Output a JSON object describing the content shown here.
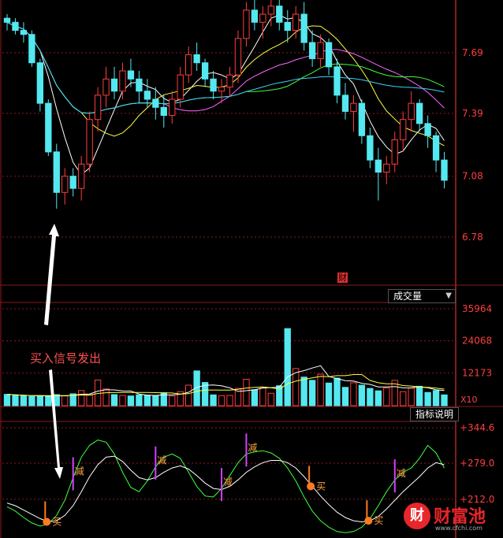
{
  "colors": {
    "up": "#ff3d3d",
    "down": "#54e8f0",
    "axis": "#ff3d3d",
    "grid": "#8b1a1a"
  },
  "price_panel": {
    "ticks": [
      "7.69",
      "7.39",
      "7.08",
      "6.78"
    ],
    "marker_label": "财"
  },
  "volume_panel": {
    "selector_label": "成交量",
    "ticks": [
      "35964",
      "24068",
      "12173"
    ],
    "unit_label": "X10"
  },
  "indicator_panel": {
    "button_label": "指标说明",
    "ticks": [
      "+344.6",
      "+279.0",
      "+212.0"
    ],
    "reduce_label": "减",
    "buy_label": "买"
  },
  "annotation": {
    "text": "买入信号发出"
  },
  "watermark": {
    "icon_text": "财",
    "name": "财富池",
    "url": "www.cfchi.com"
  },
  "chart_data": {
    "type": "candlestick",
    "price_range": [
      6.55,
      7.95
    ],
    "volume_range": [
      0,
      38000
    ],
    "indicator_range": [
      140,
      355
    ],
    "candles": [
      [
        7.86,
        7.88,
        7.8,
        7.84
      ],
      [
        7.84,
        7.86,
        7.78,
        7.8
      ],
      [
        7.8,
        7.84,
        7.74,
        7.78
      ],
      [
        7.78,
        7.8,
        7.62,
        7.64
      ],
      [
        7.64,
        7.66,
        7.4,
        7.44
      ],
      [
        7.44,
        7.46,
        7.18,
        7.2
      ],
      [
        7.2,
        7.24,
        6.92,
        7.0
      ],
      [
        7.0,
        7.12,
        6.94,
        7.08
      ],
      [
        7.08,
        7.12,
        6.98,
        7.02
      ],
      [
        7.02,
        7.18,
        6.96,
        7.14
      ],
      [
        7.14,
        7.4,
        7.1,
        7.36
      ],
      [
        7.36,
        7.52,
        7.3,
        7.48
      ],
      [
        7.48,
        7.62,
        7.42,
        7.56
      ],
      [
        7.56,
        7.62,
        7.46,
        7.5
      ],
      [
        7.5,
        7.64,
        7.46,
        7.6
      ],
      [
        7.6,
        7.66,
        7.52,
        7.56
      ],
      [
        7.56,
        7.6,
        7.44,
        7.5
      ],
      [
        7.5,
        7.56,
        7.42,
        7.46
      ],
      [
        7.46,
        7.52,
        7.36,
        7.42
      ],
      [
        7.42,
        7.48,
        7.32,
        7.38
      ],
      [
        7.38,
        7.5,
        7.34,
        7.46
      ],
      [
        7.46,
        7.62,
        7.42,
        7.58
      ],
      [
        7.58,
        7.72,
        7.54,
        7.68
      ],
      [
        7.68,
        7.74,
        7.6,
        7.64
      ],
      [
        7.64,
        7.66,
        7.52,
        7.56
      ],
      [
        7.56,
        7.6,
        7.46,
        7.5
      ],
      [
        7.5,
        7.56,
        7.44,
        7.52
      ],
      [
        7.52,
        7.62,
        7.48,
        7.58
      ],
      [
        7.58,
        7.8,
        7.54,
        7.76
      ],
      [
        7.76,
        7.94,
        7.72,
        7.9
      ],
      [
        7.9,
        7.95,
        7.8,
        7.84
      ],
      [
        7.84,
        7.92,
        7.76,
        7.88
      ],
      [
        7.88,
        7.95,
        7.82,
        7.92
      ],
      [
        7.92,
        7.95,
        7.8,
        7.84
      ],
      [
        7.84,
        7.9,
        7.74,
        7.8
      ],
      [
        7.8,
        7.92,
        7.76,
        7.88
      ],
      [
        7.88,
        7.94,
        7.7,
        7.74
      ],
      [
        7.74,
        7.8,
        7.62,
        7.66
      ],
      [
        7.66,
        7.78,
        7.62,
        7.74
      ],
      [
        7.74,
        7.76,
        7.58,
        7.62
      ],
      [
        7.62,
        7.66,
        7.44,
        7.48
      ],
      [
        7.48,
        7.54,
        7.36,
        7.4
      ],
      [
        7.4,
        7.48,
        7.3,
        7.44
      ],
      [
        7.44,
        7.46,
        7.24,
        7.28
      ],
      [
        7.28,
        7.32,
        7.12,
        7.16
      ],
      [
        7.16,
        7.22,
        6.96,
        7.1
      ],
      [
        7.1,
        7.18,
        7.04,
        7.14
      ],
      [
        7.14,
        7.3,
        7.1,
        7.26
      ],
      [
        7.26,
        7.4,
        7.2,
        7.36
      ],
      [
        7.36,
        7.5,
        7.3,
        7.44
      ],
      [
        7.44,
        7.46,
        7.3,
        7.34
      ],
      [
        7.34,
        7.38,
        7.22,
        7.28
      ],
      [
        7.28,
        7.3,
        7.1,
        7.16
      ],
      [
        7.16,
        7.2,
        7.02,
        7.06
      ]
    ],
    "volumes": [
      4200,
      3800,
      3600,
      3400,
      3700,
      3500,
      4100,
      3600,
      4400,
      5600,
      3900,
      9500,
      6200,
      4100,
      3800,
      3600,
      4000,
      3900,
      3700,
      4800,
      3600,
      5200,
      7600,
      12900,
      8600,
      4000,
      3700,
      3800,
      6400,
      9800,
      5900,
      6800,
      4600,
      7400,
      28600,
      13800,
      10600,
      9400,
      11700,
      8400,
      10200,
      6800,
      8500,
      7600,
      6400,
      5500,
      6600,
      9400,
      5200,
      6500,
      7200,
      4900,
      5600,
      4000
    ],
    "indicator": {
      "k": [
        198,
        190,
        178,
        168,
        162,
        166,
        182,
        210,
        252,
        290,
        312,
        322,
        318,
        296,
        262,
        234,
        226,
        246,
        272,
        290,
        296,
        288,
        262,
        236,
        218,
        216,
        232,
        256,
        280,
        296,
        300,
        302,
        298,
        288,
        270,
        246,
        216,
        190,
        172,
        160,
        152,
        150,
        152,
        160,
        176,
        200,
        226,
        248,
        262,
        270,
        288,
        312,
        298,
        270
      ],
      "d": [
        205,
        200,
        192,
        184,
        176,
        170,
        172,
        182,
        200,
        226,
        254,
        276,
        290,
        292,
        282,
        266,
        252,
        248,
        252,
        262,
        270,
        274,
        268,
        256,
        242,
        232,
        230,
        236,
        248,
        262,
        272,
        280,
        284,
        284,
        280,
        270,
        254,
        236,
        218,
        202,
        188,
        178,
        172,
        170,
        172,
        180,
        194,
        210,
        226,
        240,
        254,
        270,
        280,
        276
      ]
    },
    "reduce_signals": [
      8,
      18,
      26,
      29,
      47
    ],
    "buy_signals": [
      5,
      37,
      44
    ]
  }
}
